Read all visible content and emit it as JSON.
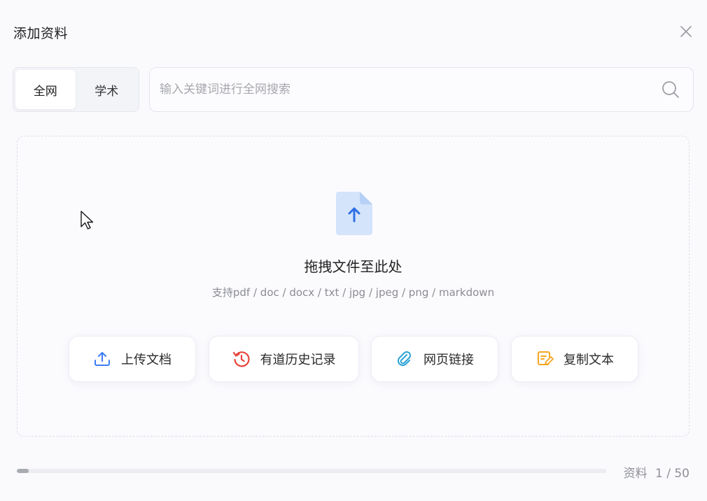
{
  "dialog": {
    "title": "添加资料"
  },
  "scope_tabs": [
    {
      "label": "全网",
      "active": true
    },
    {
      "label": "学术",
      "active": false
    }
  ],
  "search": {
    "placeholder": "输入关键词进行全网搜索",
    "value": "",
    "icon": "search-icon"
  },
  "dropzone": {
    "icon": "file-upload-icon",
    "title": "拖拽文件至此处",
    "subtitle": "支持pdf / doc / docx / txt / jpg / jpeg / png / markdown"
  },
  "actions": [
    {
      "label": "上传文档",
      "icon": "upload-icon",
      "color": "#3a7cf5"
    },
    {
      "label": "有道历史记录",
      "icon": "history-icon",
      "color": "#e8453c"
    },
    {
      "label": "网页链接",
      "icon": "link-icon",
      "color": "#2aa2d6"
    },
    {
      "label": "复制文本",
      "icon": "note-edit-icon",
      "color": "#f5a623"
    }
  ],
  "footer": {
    "count_label": "资料",
    "count_value": "1 / 50",
    "progress_fraction": 0.02
  },
  "colors": {
    "accent": "#3a7cf5",
    "file_icon_bg": "#d3e4fb",
    "background": "#fafafd"
  }
}
